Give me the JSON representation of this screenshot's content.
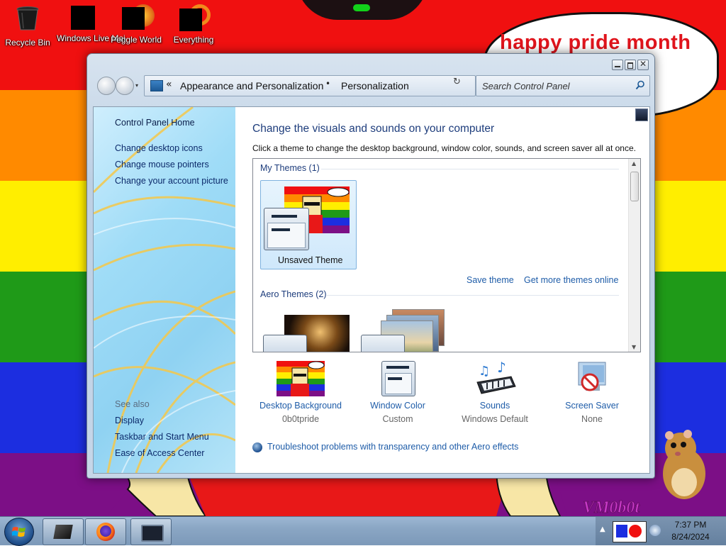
{
  "desktop": {
    "speech_bubble": "happy pride month",
    "watermark": "VM0b0t",
    "icons": [
      {
        "label": "Recycle Bin",
        "icon": "recycle-bin-icon"
      },
      {
        "label": "Windows Live Mai",
        "icon": "redacted-icon"
      },
      {
        "label": "Peggle World",
        "icon": "redacted-icon"
      },
      {
        "label": "Everything",
        "icon": "redacted-icon"
      }
    ],
    "colors": {
      "red": "#f01010",
      "orange": "#ff8a00",
      "yellow": "#ffee00",
      "green": "#1f9a18",
      "blue": "#1c2ee0",
      "purple": "#7c0f86"
    }
  },
  "window": {
    "breadcrumb": {
      "overflow": "«",
      "items": [
        "Appearance and Personalization",
        "Personalization"
      ],
      "separator": "•"
    },
    "search": {
      "placeholder": "Search Control Panel"
    },
    "sidebar": {
      "home": "Control Panel Home",
      "links": [
        "Change desktop icons",
        "Change mouse pointers",
        "Change your account picture"
      ],
      "see_also_heading": "See also",
      "see_also": [
        "Display",
        "Taskbar and Start Menu",
        "Ease of Access Center"
      ]
    },
    "main": {
      "title": "Change the visuals and sounds on your computer",
      "subtitle": "Click a theme to change the desktop background, window color, sounds, and screen saver all at once.",
      "my_themes_heading": "My Themes (1)",
      "my_themes": [
        {
          "label": "Unsaved Theme",
          "selected": true
        }
      ],
      "save_theme": "Save theme",
      "get_more": "Get more themes online",
      "aero_heading": "Aero Themes (2)",
      "bottom": [
        {
          "label": "Desktop Background",
          "value": "0b0tpride",
          "icon": "desktop-background-icon"
        },
        {
          "label": "Window Color",
          "value": "Custom",
          "icon": "window-color-icon"
        },
        {
          "label": "Sounds",
          "value": "Windows Default",
          "icon": "sounds-icon"
        },
        {
          "label": "Screen Saver",
          "value": "None",
          "icon": "screen-saver-icon"
        }
      ],
      "troubleshoot": "Troubleshoot problems with transparency and other Aero effects"
    }
  },
  "taskbar": {
    "time": "7:37 PM",
    "date": "8/24/2024",
    "pinned": [
      "app-icon",
      "firefox-icon",
      "personalization-icon"
    ]
  }
}
